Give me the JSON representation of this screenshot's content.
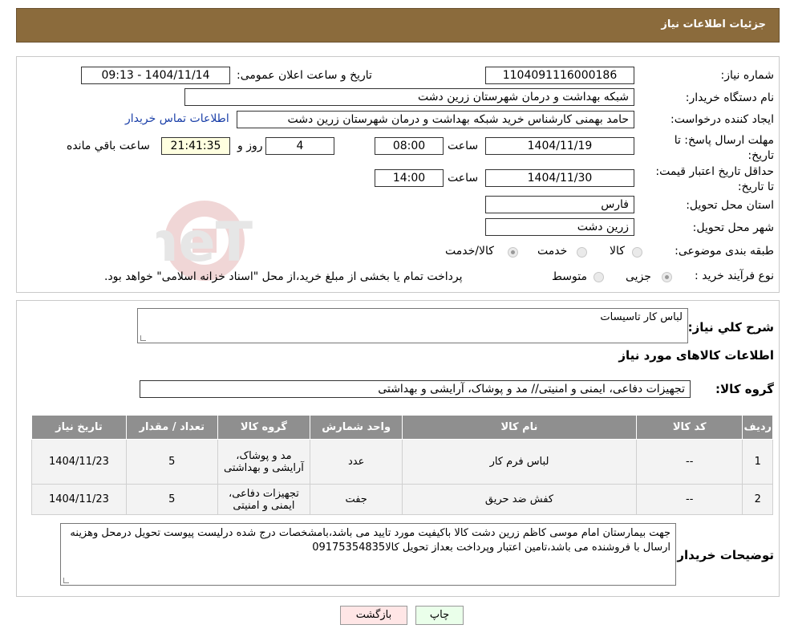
{
  "header": {
    "title": "جزئیات اطلاعات نیاز"
  },
  "form": {
    "need_number_label": "شماره نیاز:",
    "need_number": "1104091116000186",
    "announce_label": "تاریخ و ساعت اعلان عمومی:",
    "announce_value": "1404/11/14 - 09:13",
    "buyer_org_label": "نام دستگاه خریدار:",
    "buyer_org": "شبکه بهداشت و درمان شهرستان زرین دشت",
    "creator_label": "ایجاد کننده درخواست:",
    "creator": "حامد بهمنی کارشناس خرید شبکه بهداشت و درمان شهرستان زرین دشت",
    "contact_link": "اطلاعات تماس خریدار",
    "deadline_label": "مهلت ارسال پاسخ: تا تاریخ:",
    "deadline_date": "1404/11/19",
    "time_label": "ساعت",
    "deadline_time": "08:00",
    "days_value": "4",
    "days_label": "روز و",
    "remaining_time": "21:41:35",
    "remaining_label": "ساعت باقي مانده",
    "validity_label": "حداقل تاریخ اعتبار قیمت: تا تاریخ:",
    "validity_date": "1404/11/30",
    "validity_time": "14:00",
    "province_label": "استان محل تحویل:",
    "province": "فارس",
    "city_label": "شهر محل تحویل:",
    "city": "زرین دشت",
    "category_label": "طبقه بندی موضوعی:",
    "category_options": [
      "کالا",
      "خدمت",
      "کالا/خدمت"
    ],
    "process_label": "نوع فرآیند خرید :",
    "process_options": [
      "جزیی",
      "متوسط"
    ],
    "process_note": "پرداخت تمام یا بخشی از مبلغ خرید،از محل \"اسناد خزانه اسلامی\" خواهد بود."
  },
  "details": {
    "summary_label": "شرح کلي نياز:",
    "summary": "لباس کار تاسیسات",
    "items_title": "اطلاعات کالاهای مورد نیاز",
    "group_label": "گروه کالا:",
    "group": "تجهیزات دفاعی، ایمنی و امنیتی// مد و پوشاک، آرایشی و بهداشتی",
    "table_headers": [
      "ردیف",
      "کد کالا",
      "نام کالا",
      "واحد شمارش",
      "گروه کالا",
      "تعداد / مقدار",
      "تاریخ نیاز"
    ],
    "rows": [
      {
        "row": "1",
        "code": "--",
        "name": "لباس فرم کار",
        "unit": "عدد",
        "group": "مد و پوشاک، آرایشی و بهداشتی",
        "qty": "5",
        "date": "1404/11/23"
      },
      {
        "row": "2",
        "code": "--",
        "name": "کفش ضد حریق",
        "unit": "جفت",
        "group": "تجهیزات دفاعی، ایمنی و امنیتی",
        "qty": "5",
        "date": "1404/11/23"
      }
    ],
    "buyer_notes_label": "توضیحات خریدار:",
    "buyer_notes": "جهت بیمارستان امام موسی کاظم زرین دشت کالا باکیفیت  مورد تایید می باشد،بامشخصات درج شده درلیست پیوست تحویل درمحل وهزینه ارسال با فروشنده می باشد،تامین اعتبار وپرداخت بعداز تحویل کالا09175354835"
  },
  "buttons": {
    "print": "چاپ",
    "back": "بازگشت"
  },
  "watermark": {
    "text": "AriaTender.neT"
  },
  "colors": {
    "header": "#8b6b3c",
    "table_header": "#8f8f8f",
    "time_box": "#ffffe0",
    "link": "#1a3fa8"
  }
}
